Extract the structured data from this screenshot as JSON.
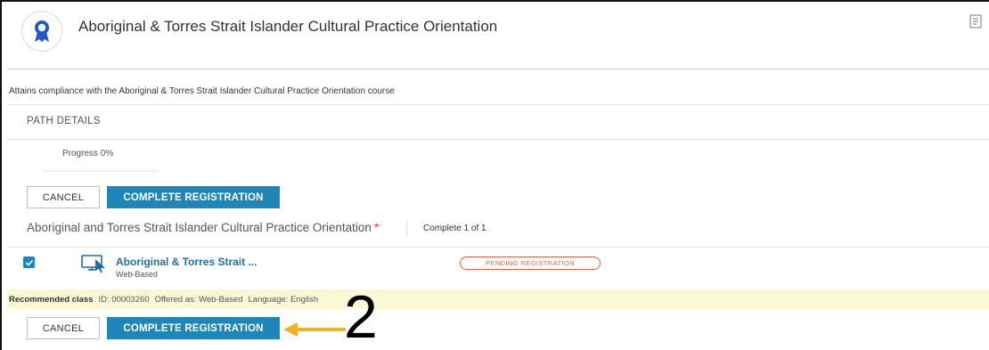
{
  "header": {
    "title": "Aboriginal & Torres Strait Islander Cultural Practice Orientation",
    "badge_icon": "award-ribbon-icon",
    "corner_icon": "export-document-icon"
  },
  "description": "Attains compliance with the Aboriginal & Torres Strait Islander Cultural Practice Orientation course",
  "path_details": {
    "heading": "PATH DETAILS",
    "progress_text": "Progress 0%",
    "progress_value": 0
  },
  "actions": {
    "cancel_label": "CANCEL",
    "complete_label": "COMPLETE REGISTRATION"
  },
  "course": {
    "title": "Aboriginal and Torres Strait Islander Cultural Practice Orientation",
    "required_marker": "*",
    "complete_count": "Complete 1 of 1"
  },
  "item": {
    "checked": true,
    "icon": "monitor-cursor-icon",
    "title": "Aboriginal & Torres Strait ...",
    "type": "Web-Based",
    "status": "PENDING REGISTRATION"
  },
  "recommended": {
    "label": "Recommended class",
    "id": "ID: 00003260",
    "offered": "Offered as: Web-Based",
    "language": "Language: English"
  },
  "annotation": {
    "step_number": "2",
    "arrow_color": "#f5b21b"
  },
  "colors": {
    "primary": "#1e86b8",
    "status": "#e5603c",
    "link": "#1e6fa6",
    "highlight": "#fbf9d3"
  }
}
